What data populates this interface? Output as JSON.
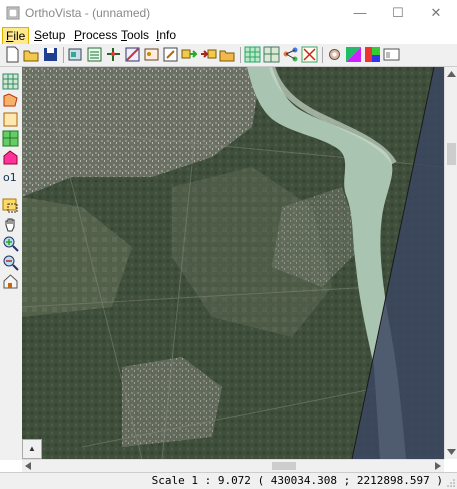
{
  "window": {
    "title": "OrthoVista - (unnamed)",
    "minimize_glyph": "—",
    "maximize_glyph": "☐",
    "close_glyph": "✕"
  },
  "menu": {
    "items": [
      {
        "label": "File",
        "mnemonic": "F",
        "rest": "ile",
        "active": true
      },
      {
        "label": "Setup",
        "mnemonic": "S",
        "rest": "etup",
        "active": false
      },
      {
        "label": "Process",
        "mnemonic": "P",
        "rest": "rocess",
        "active": false
      },
      {
        "label": "Tools",
        "mnemonic": "T",
        "rest": "ools",
        "active": false
      },
      {
        "label": "Info",
        "mnemonic": "I",
        "rest": "nfo",
        "active": false
      }
    ]
  },
  "toolbar": {
    "icons": [
      "new-file-icon",
      "open-folder-icon",
      "save-icon",
      "add-images-icon",
      "image-list-icon",
      "tie-points-icon",
      "seamline-icon",
      "color-balance-icon",
      "edit-icon",
      "export-icon",
      "import-icon",
      "folder-icon",
      "grid-icon",
      "tile-grid-icon",
      "network-icon",
      "crosshair-icon",
      "settings-icon",
      "color-palette-icon",
      "rgb-icon",
      "window-icon"
    ]
  },
  "lefttoolbar": {
    "icons": [
      "select-tool-icon",
      "polygon-tool-icon",
      "frame-tool-icon",
      "grid-tool-icon",
      "shape-tool-icon",
      "label-tool-icon",
      "zoom-window-icon",
      "pan-hand-icon",
      "zoom-in-icon",
      "zoom-out-icon",
      "home-view-icon"
    ]
  },
  "map": {
    "north_arrow": "▲"
  },
  "status": {
    "scale_label": "Scale 1 : 9.072",
    "coordinates": "( 430034.308 ; 2212898.597 )"
  },
  "colors": {
    "menu_highlight": "#ffe98c",
    "chrome": "#f0f0f0",
    "river": "#a9c4b0",
    "terrain": "#3b4b3a",
    "overlay": "#3a4560"
  }
}
